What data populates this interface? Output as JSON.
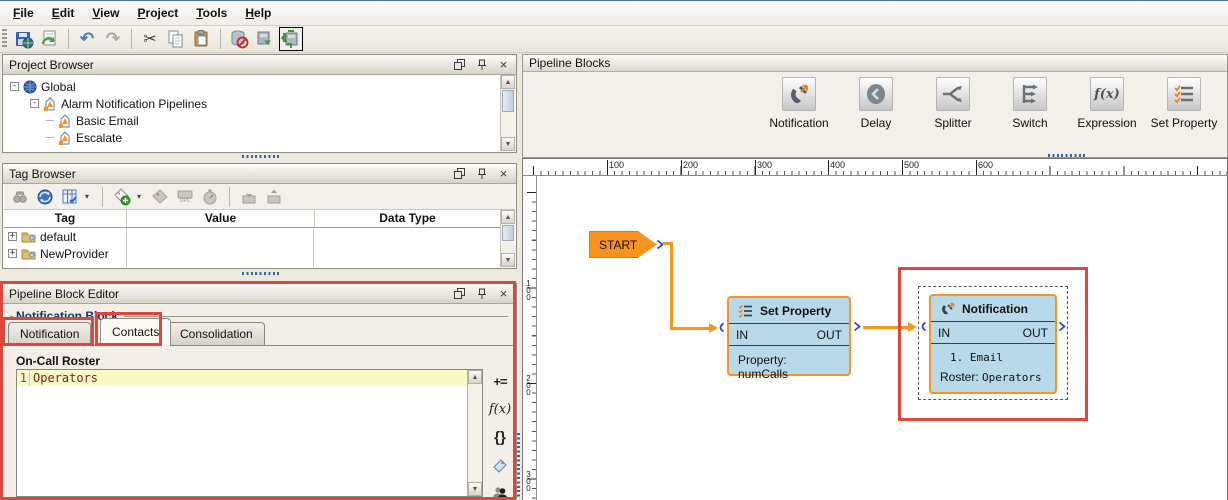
{
  "window": {
    "menu": [
      {
        "label": "File"
      },
      {
        "label": "Edit"
      },
      {
        "label": "View"
      },
      {
        "label": "Project"
      },
      {
        "label": "Tools"
      },
      {
        "label": "Help"
      }
    ]
  },
  "icons": {
    "close": "×",
    "dropdown": "▾",
    "scroll_up": "▲",
    "scroll_down": "▼",
    "undo": "↶",
    "redo": "↷",
    "cut": "✂",
    "refresh_overlay": "⟳",
    "insert": "+=",
    "function": "f(x)",
    "braces": "{}",
    "opc": "OPC",
    "expander_expanded": "-",
    "expander_collapsed": "+"
  },
  "project_browser": {
    "title": "Project Browser",
    "items": [
      {
        "label": "Global",
        "icon": "globe-icon"
      },
      {
        "label": "Alarm Notification Pipelines",
        "icon": "pipeline-icon"
      },
      {
        "label": "Basic Email",
        "icon": "pipeline-icon"
      },
      {
        "label": "Escalate",
        "icon": "pipeline-icon"
      }
    ]
  },
  "tag_browser": {
    "title": "Tag Browser",
    "columns": [
      "Tag",
      "Value",
      "Data Type"
    ],
    "rows": [
      {
        "tag": "default"
      },
      {
        "tag": "NewProvider"
      }
    ]
  },
  "pipeline_block_editor": {
    "title": "Pipeline Block Editor",
    "section_title": "Notification Block",
    "tabs": [
      {
        "label": "Notification",
        "selected": false
      },
      {
        "label": "Contacts",
        "selected": true
      },
      {
        "label": "Consolidation",
        "selected": false
      }
    ],
    "roster_label": "On-Call Roster",
    "editor": {
      "line_number": "1",
      "content": "Operators"
    }
  },
  "pipeline_blocks": {
    "title": "Pipeline Blocks",
    "palette": [
      {
        "label": "Notification"
      },
      {
        "label": "Delay"
      },
      {
        "label": "Splitter"
      },
      {
        "label": "Switch"
      },
      {
        "label": "Expression"
      },
      {
        "label": "Set Property"
      }
    ]
  },
  "canvas": {
    "h_ruler": [
      "100",
      "200",
      "300",
      "400",
      "500",
      "600"
    ],
    "v_ruler": [
      "100",
      "200",
      "300"
    ],
    "start_block": {
      "label": "START"
    },
    "set_property_block": {
      "title": "Set Property",
      "in_label": "IN",
      "out_label": "OUT",
      "body": "Property: numCalls"
    },
    "notification_block": {
      "title": "Notification",
      "in_label": "IN",
      "out_label": "OUT",
      "body_line1": "1. Email",
      "body_line2_label": "Roster:",
      "body_line2_value": "Operators"
    }
  },
  "colors": {
    "accent_orange": "#F7941D",
    "block_fill": "#B7D9EA",
    "annotation_red": "#E0463C",
    "connector_blue": "#2A3BD0",
    "current_line": "#FCFAC7"
  }
}
